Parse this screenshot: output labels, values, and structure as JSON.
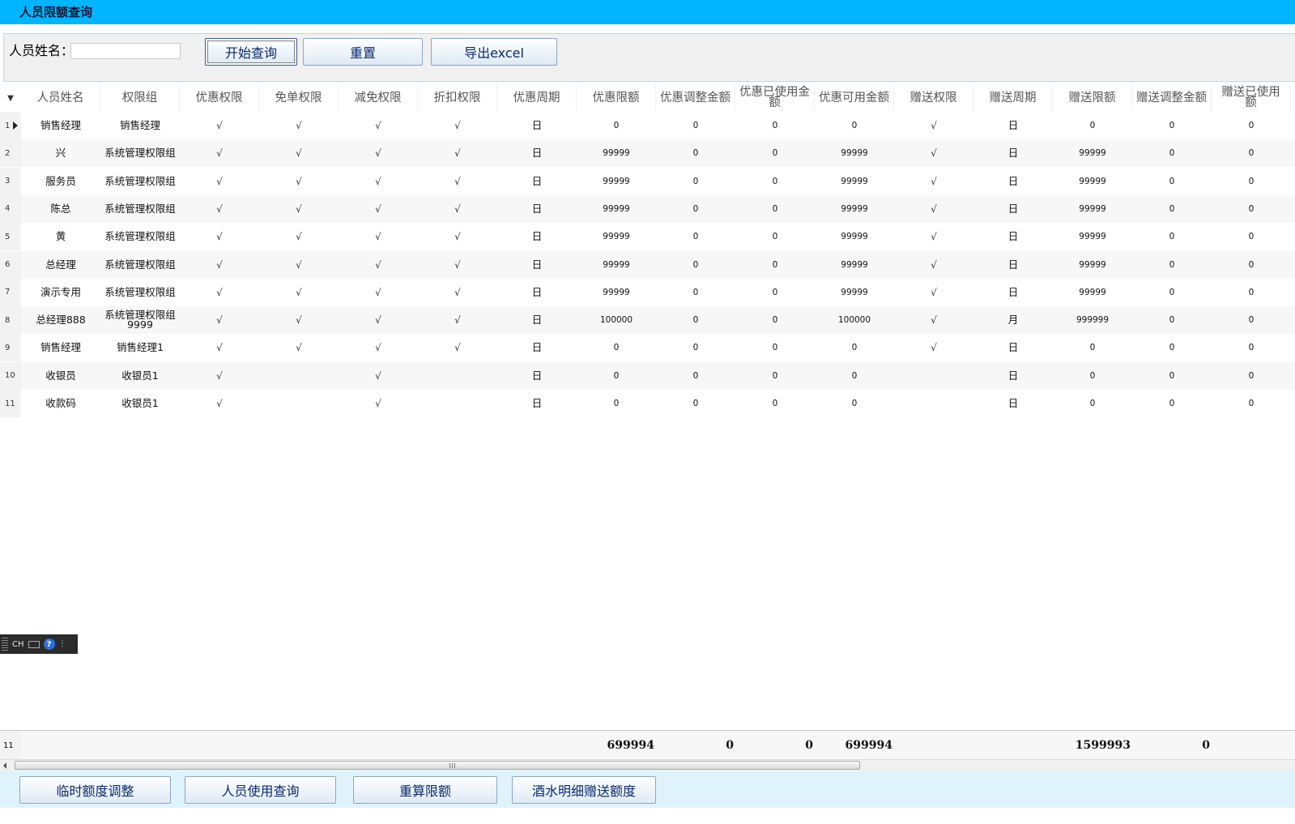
{
  "window": {
    "title": "人员限额查询"
  },
  "search": {
    "label": "人员姓名：",
    "value": "",
    "placeholder": ""
  },
  "toolbar": {
    "query_label": "开始查询",
    "reset_label": "重置",
    "export_label": "导出excel"
  },
  "columns": [
    "人员姓名",
    "权限组",
    "优惠权限",
    "免单权限",
    "减免权限",
    "折扣权限",
    "优惠周期",
    "优惠限额",
    "优惠调整金额",
    "优惠已使用金额",
    "优惠可用金额",
    "赠送权限",
    "赠送周期",
    "赠送限额",
    "赠送调整金额",
    "赠送已使用金额"
  ],
  "column_header_lines": {
    "9": [
      "优惠已使用金",
      "额"
    ],
    "15": [
      "赠送已使用",
      "额"
    ]
  },
  "rows": [
    {
      "no": "1",
      "cells": [
        "销售经理",
        "销售经理",
        "√",
        "√",
        "√",
        "√",
        "日",
        "0",
        "0",
        "0",
        "0",
        "√",
        "日",
        "0",
        "0",
        "0"
      ]
    },
    {
      "no": "2",
      "cells": [
        "兴",
        "系统管理权限组",
        "√",
        "√",
        "√",
        "√",
        "日",
        "99999",
        "0",
        "0",
        "99999",
        "√",
        "日",
        "99999",
        "0",
        "0"
      ]
    },
    {
      "no": "3",
      "cells": [
        "服务员",
        "系统管理权限组",
        "√",
        "√",
        "√",
        "√",
        "日",
        "99999",
        "0",
        "0",
        "99999",
        "√",
        "日",
        "99999",
        "0",
        "0"
      ]
    },
    {
      "no": "4",
      "cells": [
        "陈总",
        "系统管理权限组",
        "√",
        "√",
        "√",
        "√",
        "日",
        "99999",
        "0",
        "0",
        "99999",
        "√",
        "日",
        "99999",
        "0",
        "0"
      ]
    },
    {
      "no": "5",
      "cells": [
        "黄",
        "系统管理权限组",
        "√",
        "√",
        "√",
        "√",
        "日",
        "99999",
        "0",
        "0",
        "99999",
        "√",
        "日",
        "99999",
        "0",
        "0"
      ]
    },
    {
      "no": "6",
      "cells": [
        "总经理",
        "系统管理权限组",
        "√",
        "√",
        "√",
        "√",
        "日",
        "99999",
        "0",
        "0",
        "99999",
        "√",
        "日",
        "99999",
        "0",
        "0"
      ]
    },
    {
      "no": "7",
      "cells": [
        "演示专用",
        "系统管理权限组",
        "√",
        "√",
        "√",
        "√",
        "日",
        "99999",
        "0",
        "0",
        "99999",
        "√",
        "日",
        "99999",
        "0",
        "0"
      ]
    },
    {
      "no": "8",
      "cells": [
        "总经理888",
        "系统管理权限组9999",
        "√",
        "√",
        "√",
        "√",
        "日",
        "100000",
        "0",
        "0",
        "100000",
        "√",
        "月",
        "999999",
        "0",
        "0"
      ]
    },
    {
      "no": "9",
      "cells": [
        "销售经理",
        "销售经理1",
        "√",
        "√",
        "√",
        "√",
        "日",
        "0",
        "0",
        "0",
        "0",
        "√",
        "日",
        "0",
        "0",
        "0"
      ]
    },
    {
      "no": "10",
      "cells": [
        "收银员",
        "收银员1",
        "√",
        "",
        "√",
        "",
        "日",
        "0",
        "0",
        "0",
        "0",
        "",
        "日",
        "0",
        "0",
        "0"
      ]
    },
    {
      "no": "11",
      "cells": [
        "收款码",
        "收银员1",
        "√",
        "",
        "√",
        "",
        "日",
        "0",
        "0",
        "0",
        "0",
        "",
        "日",
        "0",
        "0",
        "0"
      ]
    }
  ],
  "footer": {
    "count": "11",
    "youhui_xiane": "699994",
    "youhui_tiaozheng": "0",
    "youhui_yishiyong": "0",
    "youhui_keyong": "699994",
    "zengsong_xiane": "1599993",
    "zengsong_tiaozheng": "0"
  },
  "ime": {
    "label": "CH",
    "help": "?"
  },
  "bottom": {
    "temp_adjust_label": "临时额度调整",
    "usage_query_label": "人员使用查询",
    "recalc_label": "重算限额",
    "wine_gift_label": "酒水明细赠送额度"
  }
}
